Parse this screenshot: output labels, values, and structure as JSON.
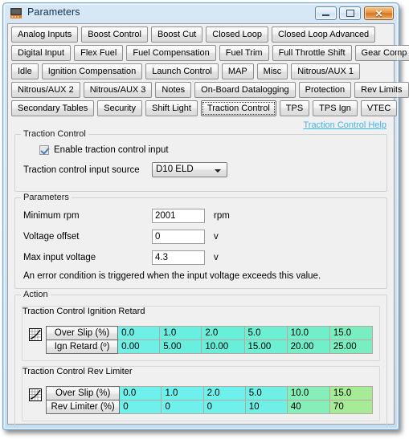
{
  "window": {
    "title": "Parameters",
    "icon": "device-icon",
    "controls": {
      "minimize": "minimize-icon",
      "maximize": "maximize-icon",
      "close": "✕"
    }
  },
  "tabs": {
    "rows": [
      [
        {
          "label": "Analog Inputs",
          "selected": false
        },
        {
          "label": "Boost Control",
          "selected": false
        },
        {
          "label": "Boost Cut",
          "selected": false
        },
        {
          "label": "Closed Loop",
          "selected": false
        },
        {
          "label": "Closed Loop Advanced",
          "selected": false
        }
      ],
      [
        {
          "label": "Digital Input",
          "selected": false
        },
        {
          "label": "Flex Fuel",
          "selected": false
        },
        {
          "label": "Fuel Compensation",
          "selected": false
        },
        {
          "label": "Fuel Trim",
          "selected": false
        },
        {
          "label": "Full Throttle Shift",
          "selected": false
        },
        {
          "label": "Gear Comp",
          "selected": false
        }
      ],
      [
        {
          "label": "Idle",
          "selected": false
        },
        {
          "label": "Ignition Compensation",
          "selected": false
        },
        {
          "label": "Launch Control",
          "selected": false
        },
        {
          "label": "MAP",
          "selected": false
        },
        {
          "label": "Misc",
          "selected": false
        },
        {
          "label": "Nitrous/AUX 1",
          "selected": false
        }
      ],
      [
        {
          "label": "Nitrous/AUX 2",
          "selected": false
        },
        {
          "label": "Nitrous/AUX 3",
          "selected": false
        },
        {
          "label": "Notes",
          "selected": false
        },
        {
          "label": "On-Board Datalogging",
          "selected": false
        },
        {
          "label": "Protection",
          "selected": false
        },
        {
          "label": "Rev Limits",
          "selected": false
        }
      ],
      [
        {
          "label": "Secondary Tables",
          "selected": false
        },
        {
          "label": "Security",
          "selected": false
        },
        {
          "label": "Shift Light",
          "selected": false
        },
        {
          "label": "Traction Control",
          "selected": true
        },
        {
          "label": "TPS",
          "selected": false
        },
        {
          "label": "TPS Ign",
          "selected": false
        },
        {
          "label": "VTEC",
          "selected": false
        }
      ]
    ]
  },
  "page": {
    "help_link": "Traction Control Help",
    "traction_control": {
      "title": "Traction Control",
      "enable_checkbox_label": "Enable traction control input",
      "enable_checked": true,
      "source_label": "Traction control input source",
      "source_value": "D10 ELD"
    },
    "parameters": {
      "title": "Parameters",
      "fields": [
        {
          "label": "Minimum rpm",
          "value": "2001",
          "unit": "rpm"
        },
        {
          "label": "Voltage offset",
          "value": "0",
          "unit": "v"
        },
        {
          "label": "Max input voltage",
          "value": "4.3",
          "unit": "v"
        }
      ],
      "note": "An error condition is triggered when the input voltage exceeds this value."
    },
    "action": {
      "title": "Action",
      "ignition_retard": {
        "title": "Traction Control Ignition Retard",
        "icon": "map-grid-icon",
        "row_headers": [
          "Over Slip (%)",
          "Ign Retard (º)"
        ],
        "over_slip": [
          "0.0",
          "1.0",
          "2.0",
          "5.0",
          "10.0",
          "15.0"
        ],
        "values": [
          "0.00",
          "5.00",
          "10.00",
          "15.00",
          "20.00",
          "25.00"
        ]
      },
      "rev_limiter": {
        "title": "Traction Control Rev Limiter",
        "icon": "map-grid-icon",
        "row_headers": [
          "Over Slip (%)",
          "Rev Limiter (%)"
        ],
        "over_slip": [
          "0.0",
          "1.0",
          "2.0",
          "5.0",
          "10.0",
          "15.0"
        ],
        "values": [
          "0",
          "0",
          "0",
          "10",
          "40",
          "70"
        ]
      }
    }
  },
  "colors": {
    "accent_link": "#3fb5f0",
    "table_cyan": "#6ef0ec",
    "table_green": "#a6eb96",
    "titlebar_start": "#d7e7f5",
    "close_button": "#e8933e"
  }
}
